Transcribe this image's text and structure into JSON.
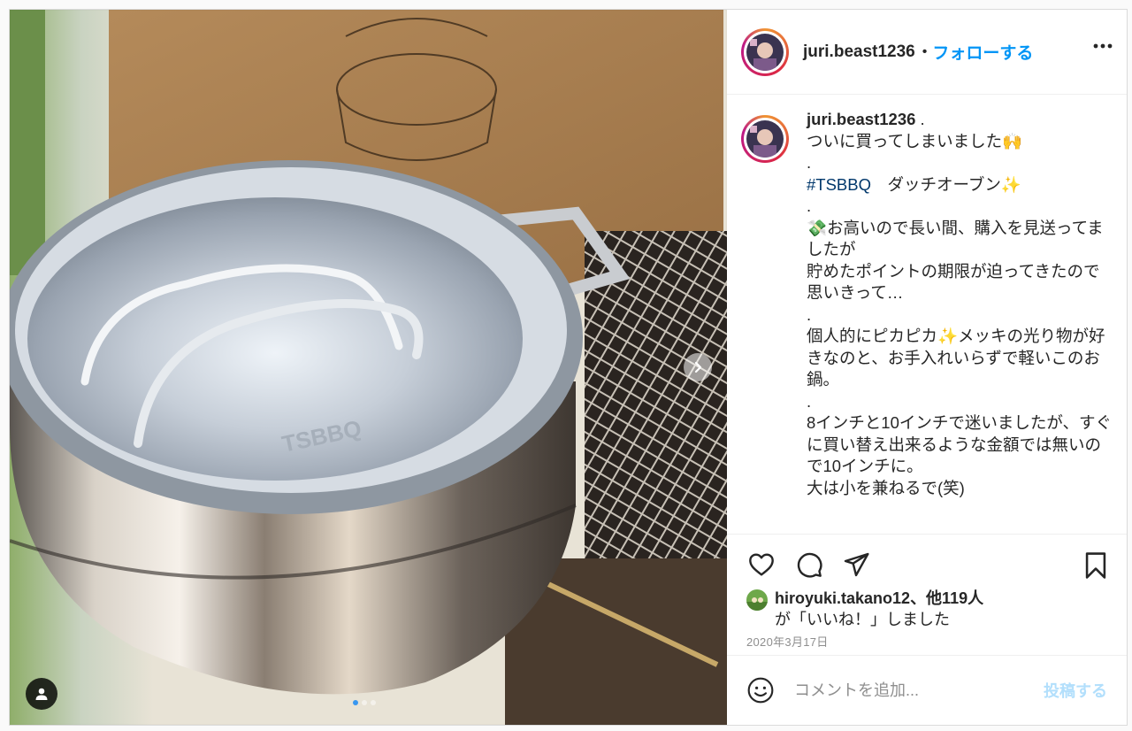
{
  "header": {
    "username": "juri.beast1236",
    "separator": "•",
    "follow_label": "フォローする",
    "more_icon": "more-horizontal-icon"
  },
  "caption": {
    "username": "juri.beast1236",
    "text_after_username": " .",
    "lines_a": "ついに買ってしまいました🙌\n.",
    "hashtag": "#TSBBQ",
    "hashtag_suffix": "　ダッチオーブン✨",
    "lines_b": ".\n💸お高いので長い間、購入を見送ってましたが\n貯めたポイントの期限が迫ってきたので思いきって…\n.\n個人的にピカピカ✨メッキの光り物が好きなのと、お手入れいらずで軽いこのお鍋。\n.\n8インチと10インチで迷いましたが、すぐに買い替え出来るような金額では無いので10インチに。\n大は小を兼ねるで(笑)"
  },
  "actions": {
    "like_icon": "heart-icon",
    "comment_icon": "comment-icon",
    "share_icon": "send-icon",
    "save_icon": "bookmark-icon"
  },
  "likes": {
    "liker": "hiroyuki.takano12",
    "others": "、他119人",
    "suffix": "が「いいね！」しました"
  },
  "date": "2020年3月17日",
  "comment_box": {
    "emoji_icon": "emoji-icon",
    "placeholder": "コメントを追加...",
    "post_label": "投稿する"
  },
  "carousel": {
    "count": 3,
    "active_index": 0,
    "next_icon": "chevron-right-icon",
    "user_tag_icon": "user-icon"
  },
  "colors": {
    "link_blue": "#0095f6",
    "hashtag": "#00376b",
    "post_disabled": "#b2dffc",
    "muted": "#8e8e8e"
  }
}
